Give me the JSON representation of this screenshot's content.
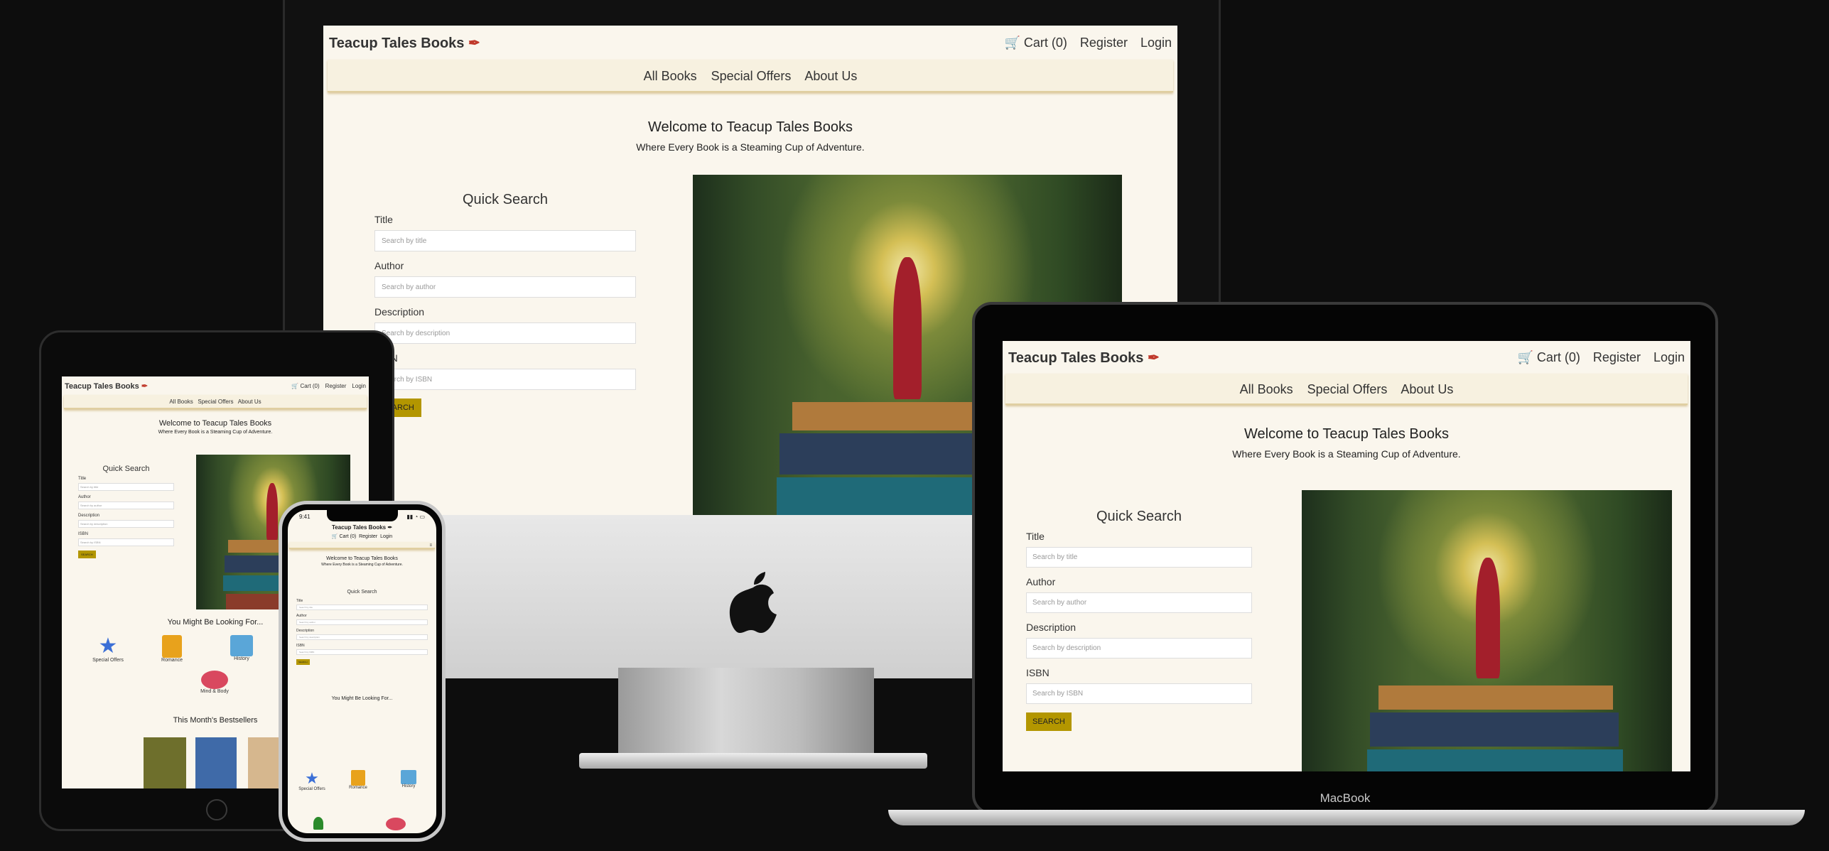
{
  "site": {
    "brand": "Teacup Tales Books",
    "brand_icon": "feather-icon",
    "cart": "Cart (0)",
    "register": "Register",
    "login": "Login",
    "nav": [
      "All Books",
      "Special Offers",
      "About Us"
    ],
    "welcome": "Welcome to Teacup Tales Books",
    "tagline": "Where Every Book is a Steaming Cup of Adventure.",
    "quick_search": {
      "title": "Quick Search",
      "fields": [
        {
          "label": "Title",
          "placeholder": "Search by title"
        },
        {
          "label": "Author",
          "placeholder": "Search by author"
        },
        {
          "label": "Description",
          "placeholder": "Search by description"
        },
        {
          "label": "ISBN",
          "placeholder": "Search by ISBN"
        }
      ],
      "button": "SEARCH"
    },
    "looking_for": {
      "title": "You Might Be Looking For...",
      "items": [
        {
          "label": "Special Offers",
          "icon": "star-icon",
          "color": "#3b6fd6"
        },
        {
          "label": "Romance",
          "icon": "book-icon",
          "color": "#e8a21c"
        },
        {
          "label": "History",
          "icon": "newspaper-icon",
          "color": "#5aa6d8"
        },
        {
          "label": "Mind & Body",
          "icon": "brain-icon",
          "color": "#d9485f"
        }
      ]
    },
    "bestsellers": {
      "title": "This Month's Bestsellers"
    }
  },
  "devices": {
    "phone_time": "9:41",
    "macbook_label": "MacBook"
  },
  "colors": {
    "accent": "#b39600",
    "background": "#faf6ed",
    "nav_bar": "#f7f1e0"
  }
}
